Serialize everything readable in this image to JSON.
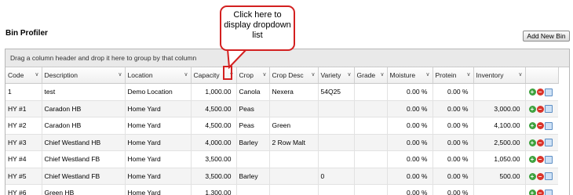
{
  "page": {
    "title": "Bin Profiler"
  },
  "toolbar": {
    "add_label": "Add New Bin"
  },
  "grid": {
    "group_hint": "Drag a column header and drop it here to group by that column",
    "columns": [
      "Code",
      "Description",
      "Location",
      "Capacity",
      "Crop",
      "Crop Desc",
      "Variety",
      "Grade",
      "Moisture",
      "Protein",
      "Inventory"
    ],
    "rows": [
      {
        "code": "1",
        "description": "test",
        "location": "Demo Location",
        "capacity": "1,000.00",
        "crop": "Canola",
        "crop_desc": "Nexera",
        "variety": "54Q25",
        "grade": "",
        "moisture": "0.00 %",
        "protein": "0.00 %",
        "inventory": ""
      },
      {
        "code": "HY #1",
        "description": "Caradon HB",
        "location": "Home Yard",
        "capacity": "4,500.00",
        "crop": "Peas",
        "crop_desc": "",
        "variety": "",
        "grade": "",
        "moisture": "0.00 %",
        "protein": "0.00 %",
        "inventory": "3,000.00"
      },
      {
        "code": "HY #2",
        "description": "Caradon HB",
        "location": "Home Yard",
        "capacity": "4,500.00",
        "crop": "Peas",
        "crop_desc": "Green",
        "variety": "",
        "grade": "",
        "moisture": "0.00 %",
        "protein": "0.00 %",
        "inventory": "4,100.00"
      },
      {
        "code": "HY #3",
        "description": "Chief Westland HB",
        "location": "Home Yard",
        "capacity": "4,000.00",
        "crop": "Barley",
        "crop_desc": "2 Row Malt",
        "variety": "",
        "grade": "",
        "moisture": "0.00 %",
        "protein": "0.00 %",
        "inventory": "2,500.00"
      },
      {
        "code": "HY #4",
        "description": "Chief Westland FB",
        "location": "Home Yard",
        "capacity": "3,500.00",
        "crop": "",
        "crop_desc": "",
        "variety": "",
        "grade": "",
        "moisture": "0.00 %",
        "protein": "0.00 %",
        "inventory": "1,050.00"
      },
      {
        "code": "HY #5",
        "description": "Chief Westland FB",
        "location": "Home Yard",
        "capacity": "3,500.00",
        "crop": "Barley",
        "crop_desc": "",
        "variety": "0",
        "grade": "",
        "moisture": "0.00 %",
        "protein": "0.00 %",
        "inventory": "500.00"
      },
      {
        "code": "HY #6",
        "description": "Green HB",
        "location": "Home Yard",
        "capacity": "1,300.00",
        "crop": "",
        "crop_desc": "",
        "variety": "",
        "grade": "",
        "moisture": "0.00 %",
        "protein": "0.00 %",
        "inventory": ""
      }
    ]
  },
  "callout": {
    "text": "Click here to display dropdown list"
  },
  "colors": {
    "callout_border": "#d32020",
    "add_icon": "#3da13d",
    "delete_icon": "#d9342b"
  },
  "icons": {
    "row_actions": [
      "add-icon",
      "delete-icon",
      "edit-icon"
    ],
    "column_menu": "chevron-down-icon"
  }
}
